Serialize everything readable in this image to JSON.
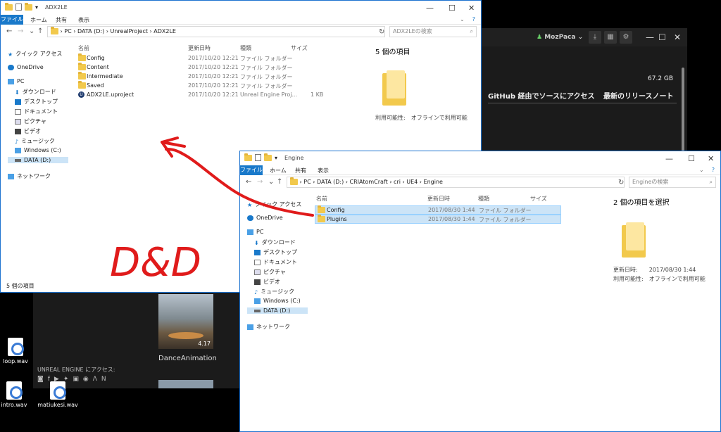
{
  "launcher": {
    "user": "MozPaca",
    "storage": "67.2 GB",
    "github_link": "GitHub 経由でソースにアクセス",
    "release_notes": "最新のリリースノート",
    "sample_name": "DanceAnimation",
    "sample_version": "4.17",
    "ue_access": "UNREAL ENGINE にアクセス:"
  },
  "desktop": {
    "icons": [
      "loop.wav",
      "intro.wav",
      "matiukesi.wav"
    ]
  },
  "explorer1": {
    "title": "ADX2LE",
    "ribbon": {
      "file": "ファイル",
      "home": "ホーム",
      "share": "共有",
      "view": "表示"
    },
    "path": "›  PC  ›  DATA (D:)  ›  UnrealProject  ›  ADX2LE",
    "search_placeholder": "ADX2LEの検索",
    "sidebar": [
      "クイック アクセス",
      "OneDrive",
      "PC",
      "ダウンロード",
      "デスクトップ",
      "ドキュメント",
      "ピクチャ",
      "ビデオ",
      "ミュージック",
      "Windows (C:)",
      "DATA (D:)",
      "ネットワーク"
    ],
    "columns": {
      "name": "名前",
      "date": "更新日時",
      "type": "種類",
      "size": "サイズ"
    },
    "rows": [
      {
        "name": "Config",
        "date": "2017/10/20 12:21",
        "type": "ファイル フォルダー",
        "size": ""
      },
      {
        "name": "Content",
        "date": "2017/10/20 12:21",
        "type": "ファイル フォルダー",
        "size": ""
      },
      {
        "name": "Intermediate",
        "date": "2017/10/20 12:21",
        "type": "ファイル フォルダー",
        "size": ""
      },
      {
        "name": "Saved",
        "date": "2017/10/20 12:21",
        "type": "ファイル フォルダー",
        "size": ""
      },
      {
        "name": "ADX2LE.uproject",
        "date": "2017/10/20 12:21",
        "type": "Unreal Engine Proj...",
        "size": "1 KB"
      }
    ],
    "detail_count": "5 個の項目",
    "detail_availability": "利用可能性:　オフラインで利用可能",
    "status": "5 個の項目"
  },
  "explorer2": {
    "title": "Engine",
    "ribbon": {
      "file": "ファイル",
      "home": "ホーム",
      "share": "共有",
      "view": "表示"
    },
    "path": "›  PC  ›  DATA (D:)  ›  CRIAtomCraft  ›  cri  ›  UE4  ›  Engine",
    "search_placeholder": "Engineの検索",
    "sidebar": [
      "クイック アクセス",
      "OneDrive",
      "PC",
      "ダウンロード",
      "デスクトップ",
      "ドキュメント",
      "ピクチャ",
      "ビデオ",
      "ミュージック",
      "Windows (C:)",
      "DATA (D:)",
      "ネットワーク"
    ],
    "columns": {
      "name": "名前",
      "date": "更新日時",
      "type": "種類",
      "size": "サイズ"
    },
    "rows": [
      {
        "name": "Config",
        "date": "2017/08/30 1:44",
        "type": "ファイル フォルダー"
      },
      {
        "name": "Plugins",
        "date": "2017/08/30 1:44",
        "type": "ファイル フォルダー"
      }
    ],
    "detail_count": "2 個の項目を選択",
    "detail_updated": "更新日時:　　2017/08/30 1:44",
    "detail_availability": "利用可能性:　オフラインで利用可能"
  },
  "annotation": {
    "text": "D&D",
    "color": "#e01b1b"
  }
}
